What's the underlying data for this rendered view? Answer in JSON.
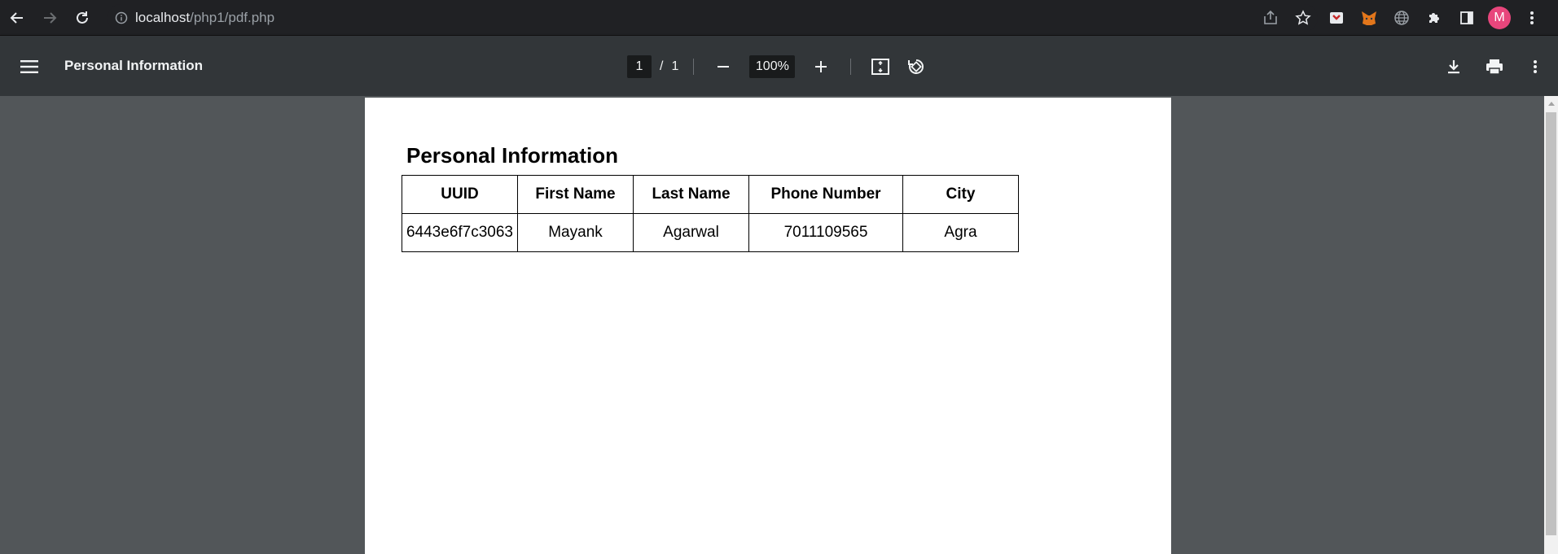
{
  "browser": {
    "url_host": "localhost",
    "url_path": "/php1/pdf.php",
    "avatar_letter": "M"
  },
  "toolbar": {
    "title": "Personal Information",
    "current_page": "1",
    "page_separator": "/",
    "total_pages": "1",
    "zoom": "100%"
  },
  "document": {
    "heading": "Personal Information",
    "table": {
      "headers": [
        "UUID",
        "First Name",
        "Last Name",
        "Phone Number",
        "City"
      ],
      "rows": [
        [
          "6443e6f7c3063",
          "Mayank",
          "Agarwal",
          "7011109565",
          "Agra"
        ]
      ]
    }
  },
  "colors": {
    "chrome_bg": "#202124",
    "toolbar_bg": "#323639",
    "viewer_bg": "#525659",
    "avatar_bg": "#e8467c"
  }
}
